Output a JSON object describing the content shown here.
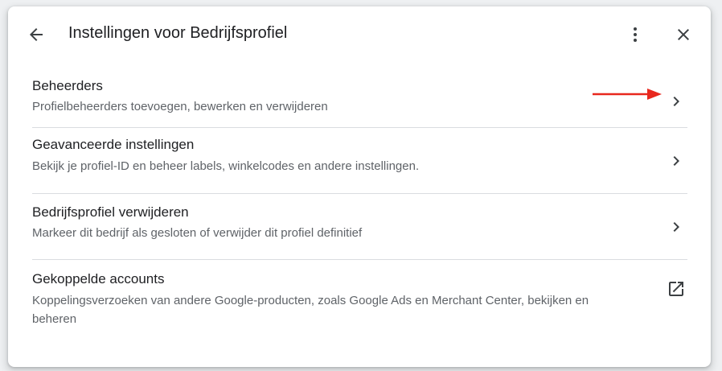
{
  "dialog": {
    "title": "Instellingen voor Bedrijfsprofiel",
    "back_icon": "arrow-back-icon",
    "more_icon": "more-vert-icon",
    "close_icon": "close-icon"
  },
  "items": [
    {
      "title": "Beheerders",
      "description": "Profielbeheerders toevoegen, bewerken en verwijderen",
      "trailing_icon": "chevron-right-icon"
    },
    {
      "title": "Geavanceerde instellingen",
      "description": "Bekijk je profiel-ID en beheer labels, winkelcodes en andere instellingen.",
      "trailing_icon": "chevron-right-icon"
    },
    {
      "title": "Bedrijfsprofiel verwijderen",
      "description": "Markeer dit bedrijf als gesloten of verwijder dit profiel definitief",
      "trailing_icon": "chevron-right-icon"
    },
    {
      "title": "Gekoppelde accounts",
      "description": "Koppelingsverzoeken van andere Google-producten, zoals Google Ads en Merchant Center, bekijken en beheren",
      "trailing_icon": "open-in-new-icon"
    }
  ],
  "annotation": {
    "arrow_color": "#e8281e",
    "arrow_icon": "red-arrow-annotation-icon"
  },
  "colors": {
    "primary_text": "#202124",
    "secondary_text": "#5f6368",
    "divider": "#dadce0",
    "icon": "#3c4043"
  }
}
